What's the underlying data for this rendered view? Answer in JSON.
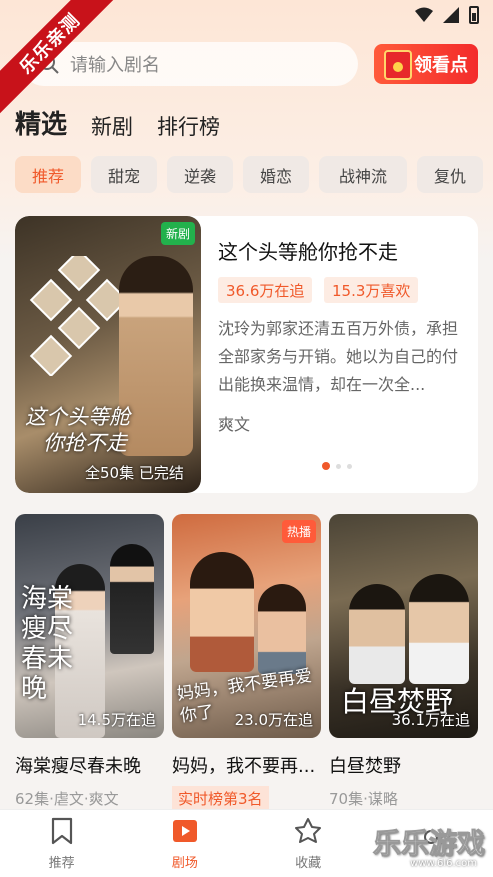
{
  "watermark_corner": "乐乐亲测",
  "search": {
    "placeholder": "请输入剧名"
  },
  "reward_button": "领看点",
  "tabs": [
    {
      "label": "精选",
      "active": true
    },
    {
      "label": "新剧",
      "active": false
    },
    {
      "label": "排行榜",
      "active": false
    }
  ],
  "categories": [
    {
      "label": "推荐",
      "active": true
    },
    {
      "label": "甜宠",
      "active": false
    },
    {
      "label": "逆袭",
      "active": false
    },
    {
      "label": "婚恋",
      "active": false
    },
    {
      "label": "战神流",
      "active": false
    },
    {
      "label": "复仇",
      "active": false
    }
  ],
  "featured": {
    "badge": "新剧",
    "poster_title_line1": "这个头等舱",
    "poster_title_line2": "你抢不走",
    "episodes": "全50集 已完结",
    "title": "这个头等舱你抢不走",
    "followers": "36.6万在追",
    "likes": "15.3万喜欢",
    "description": "沈玲为郭家还清五百万外债，承担全部家务与开销。她以为自己的付出能换来温情，却在一次全...",
    "tag": "爽文",
    "carousel_total": 3,
    "carousel_active": 1
  },
  "grid": [
    {
      "poster_text": "海棠瘦尽春未晚",
      "count": "14.5万在追",
      "title": "海棠瘦尽春未晚",
      "sub": "62集·虐文·爽文",
      "hot": "",
      "rank": ""
    },
    {
      "poster_text": "妈妈，我不要再爱你了",
      "count": "23.0万在追",
      "title": "妈妈，我不要再...",
      "sub": "",
      "hot": "热播",
      "rank": "实时榜第3名"
    },
    {
      "poster_text": "白昼焚野",
      "count": "36.1万在追",
      "title": "白昼焚野",
      "sub": "70集·谋略",
      "hot": "",
      "rank": ""
    }
  ],
  "bottom_nav": [
    {
      "label": "推荐",
      "icon": "bookmark-icon",
      "active": false
    },
    {
      "label": "剧场",
      "icon": "play-icon",
      "active": true
    },
    {
      "label": "收藏",
      "icon": "star-icon",
      "active": false
    },
    {
      "label": "",
      "icon": "profile-icon",
      "active": false
    }
  ],
  "watermark": {
    "text": "乐乐游戏",
    "url": "www.6l6.com"
  },
  "colors": {
    "accent": "#f0592a",
    "new_badge": "#22b14c",
    "hot_badge": "#ff5b3a"
  }
}
